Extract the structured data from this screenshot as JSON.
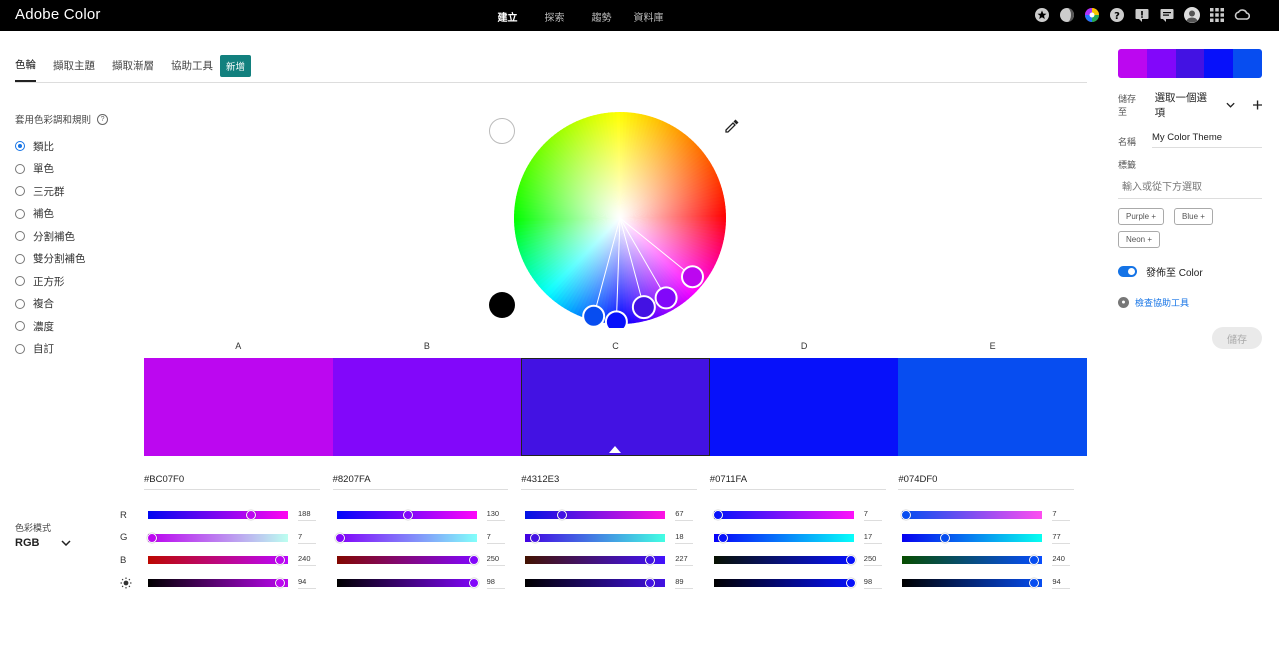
{
  "app": {
    "title": "Adobe Color"
  },
  "topnav": {
    "items": [
      "建立",
      "探索",
      "趨勢",
      "資料庫"
    ],
    "active": "建立"
  },
  "topicons": [
    "star-icon",
    "moon-icon",
    "color-wheel-icon",
    "help-icon",
    "alert-icon",
    "chat-icon",
    "avatar",
    "grid-apps-icon",
    "creative-cloud-icon"
  ],
  "tabs": {
    "items": [
      "色輪",
      "擷取主題",
      "擷取漸層",
      "協助工具"
    ],
    "active": "色輪",
    "new_badge": "新增"
  },
  "rules": {
    "title": "套用色彩調和規則",
    "help_icon": "?",
    "items": [
      "類比",
      "單色",
      "三元群",
      "補色",
      "分割補色",
      "雙分割補色",
      "正方形",
      "複合",
      "濃度",
      "自訂"
    ],
    "selected": "類比"
  },
  "wheel": {
    "handles": [
      {
        "hex": "#BC07F0",
        "angle_deg": 39,
        "radius_frac": 0.88
      },
      {
        "hex": "#8207FA",
        "angle_deg": 60,
        "radius_frac": 0.87
      },
      {
        "hex": "#4312E3",
        "angle_deg": 75,
        "radius_frac": 0.87
      },
      {
        "hex": "#0711FA",
        "angle_deg": 92,
        "radius_frac": 0.98
      },
      {
        "hex": "#074DF0",
        "angle_deg": 105,
        "radius_frac": 0.96
      }
    ],
    "white_swatch": "#FFFFFF",
    "black_swatch": "#000000"
  },
  "columns": {
    "labels": [
      "A",
      "B",
      "C",
      "D",
      "E"
    ],
    "selected": "C"
  },
  "colors": [
    {
      "hex": "#BC07F0",
      "r": 188,
      "g": 7,
      "b": 240,
      "bright": 94
    },
    {
      "hex": "#8207FA",
      "r": 130,
      "g": 7,
      "b": 250,
      "bright": 98
    },
    {
      "hex": "#4312E3",
      "r": 67,
      "g": 18,
      "b": 227,
      "bright": 89
    },
    {
      "hex": "#0711FA",
      "r": 7,
      "g": 17,
      "b": 250,
      "bright": 98
    },
    {
      "hex": "#074DF0",
      "r": 7,
      "g": 77,
      "b": 240,
      "bright": 94
    }
  ],
  "channels": [
    "R",
    "G",
    "B",
    "brightness-icon"
  ],
  "mode": {
    "label": "色彩模式",
    "value": "RGB"
  },
  "side": {
    "save_to_label": "儲存至",
    "save_to_value": "選取一個選項",
    "name_label": "名稱",
    "name_value": "My Color Theme",
    "tags_label": "標籤",
    "tags_placeholder": "輸入或從下方選取",
    "tags": [
      "Purple",
      "Blue",
      "Neon"
    ],
    "publish_label": "發佈至 Color",
    "publish_on": true,
    "a11y_link": "檢查協助工具",
    "save_button": "儲存"
  }
}
